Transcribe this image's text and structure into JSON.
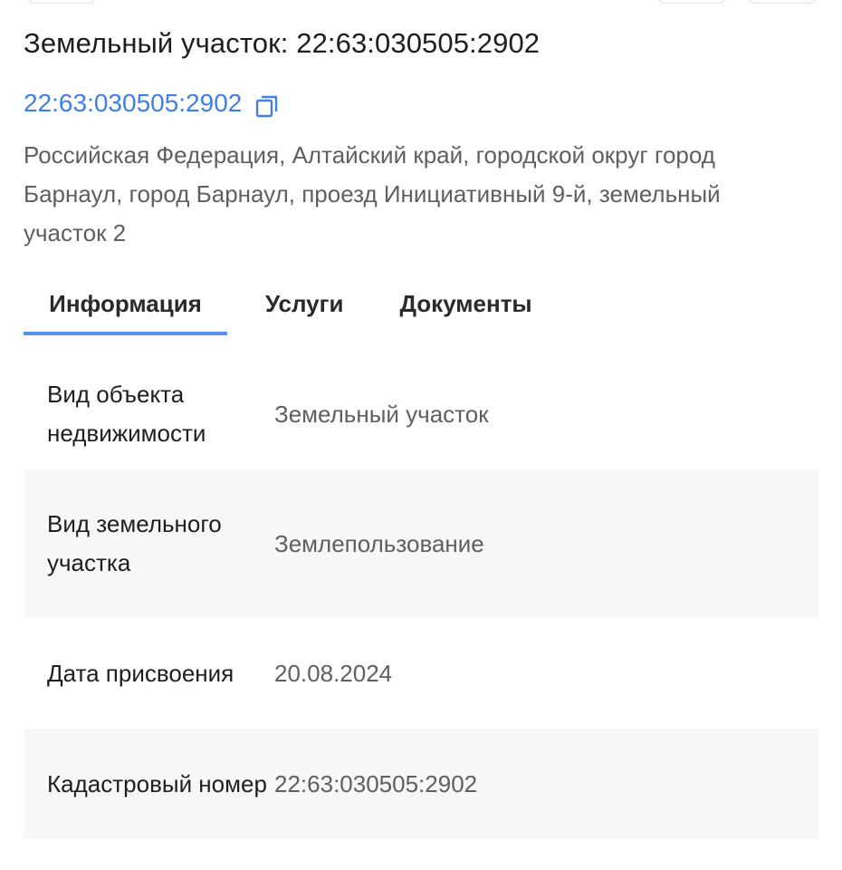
{
  "header": {
    "title": "Земельный участок: 22:63:030505:2902",
    "cadastral_link": "22:63:030505:2902",
    "copy_icon": "copy-icon",
    "address": "Российская Федерация, Алтайский край, городской округ город Барнаул, город Барнаул, проезд Инициативный 9-й, земельный участок 2"
  },
  "tabs": [
    {
      "label": "Информация",
      "active": true
    },
    {
      "label": "Услуги",
      "active": false
    },
    {
      "label": "Документы",
      "active": false
    }
  ],
  "info_rows": [
    {
      "key": "Вид объекта недвижимости",
      "value": "Земельный участок"
    },
    {
      "key": "Вид земельного участка",
      "value": "Землепользование"
    },
    {
      "key": "Дата присвоения",
      "value": "20.08.2024"
    },
    {
      "key": "Кадастровый номер",
      "value": "22:63:030505:2902"
    }
  ],
  "colors": {
    "link": "#3f7fe8",
    "tab_underline": "#5a8ff0",
    "row_alt_bg": "#f6f7f9",
    "muted_text": "#5f5f5f"
  }
}
